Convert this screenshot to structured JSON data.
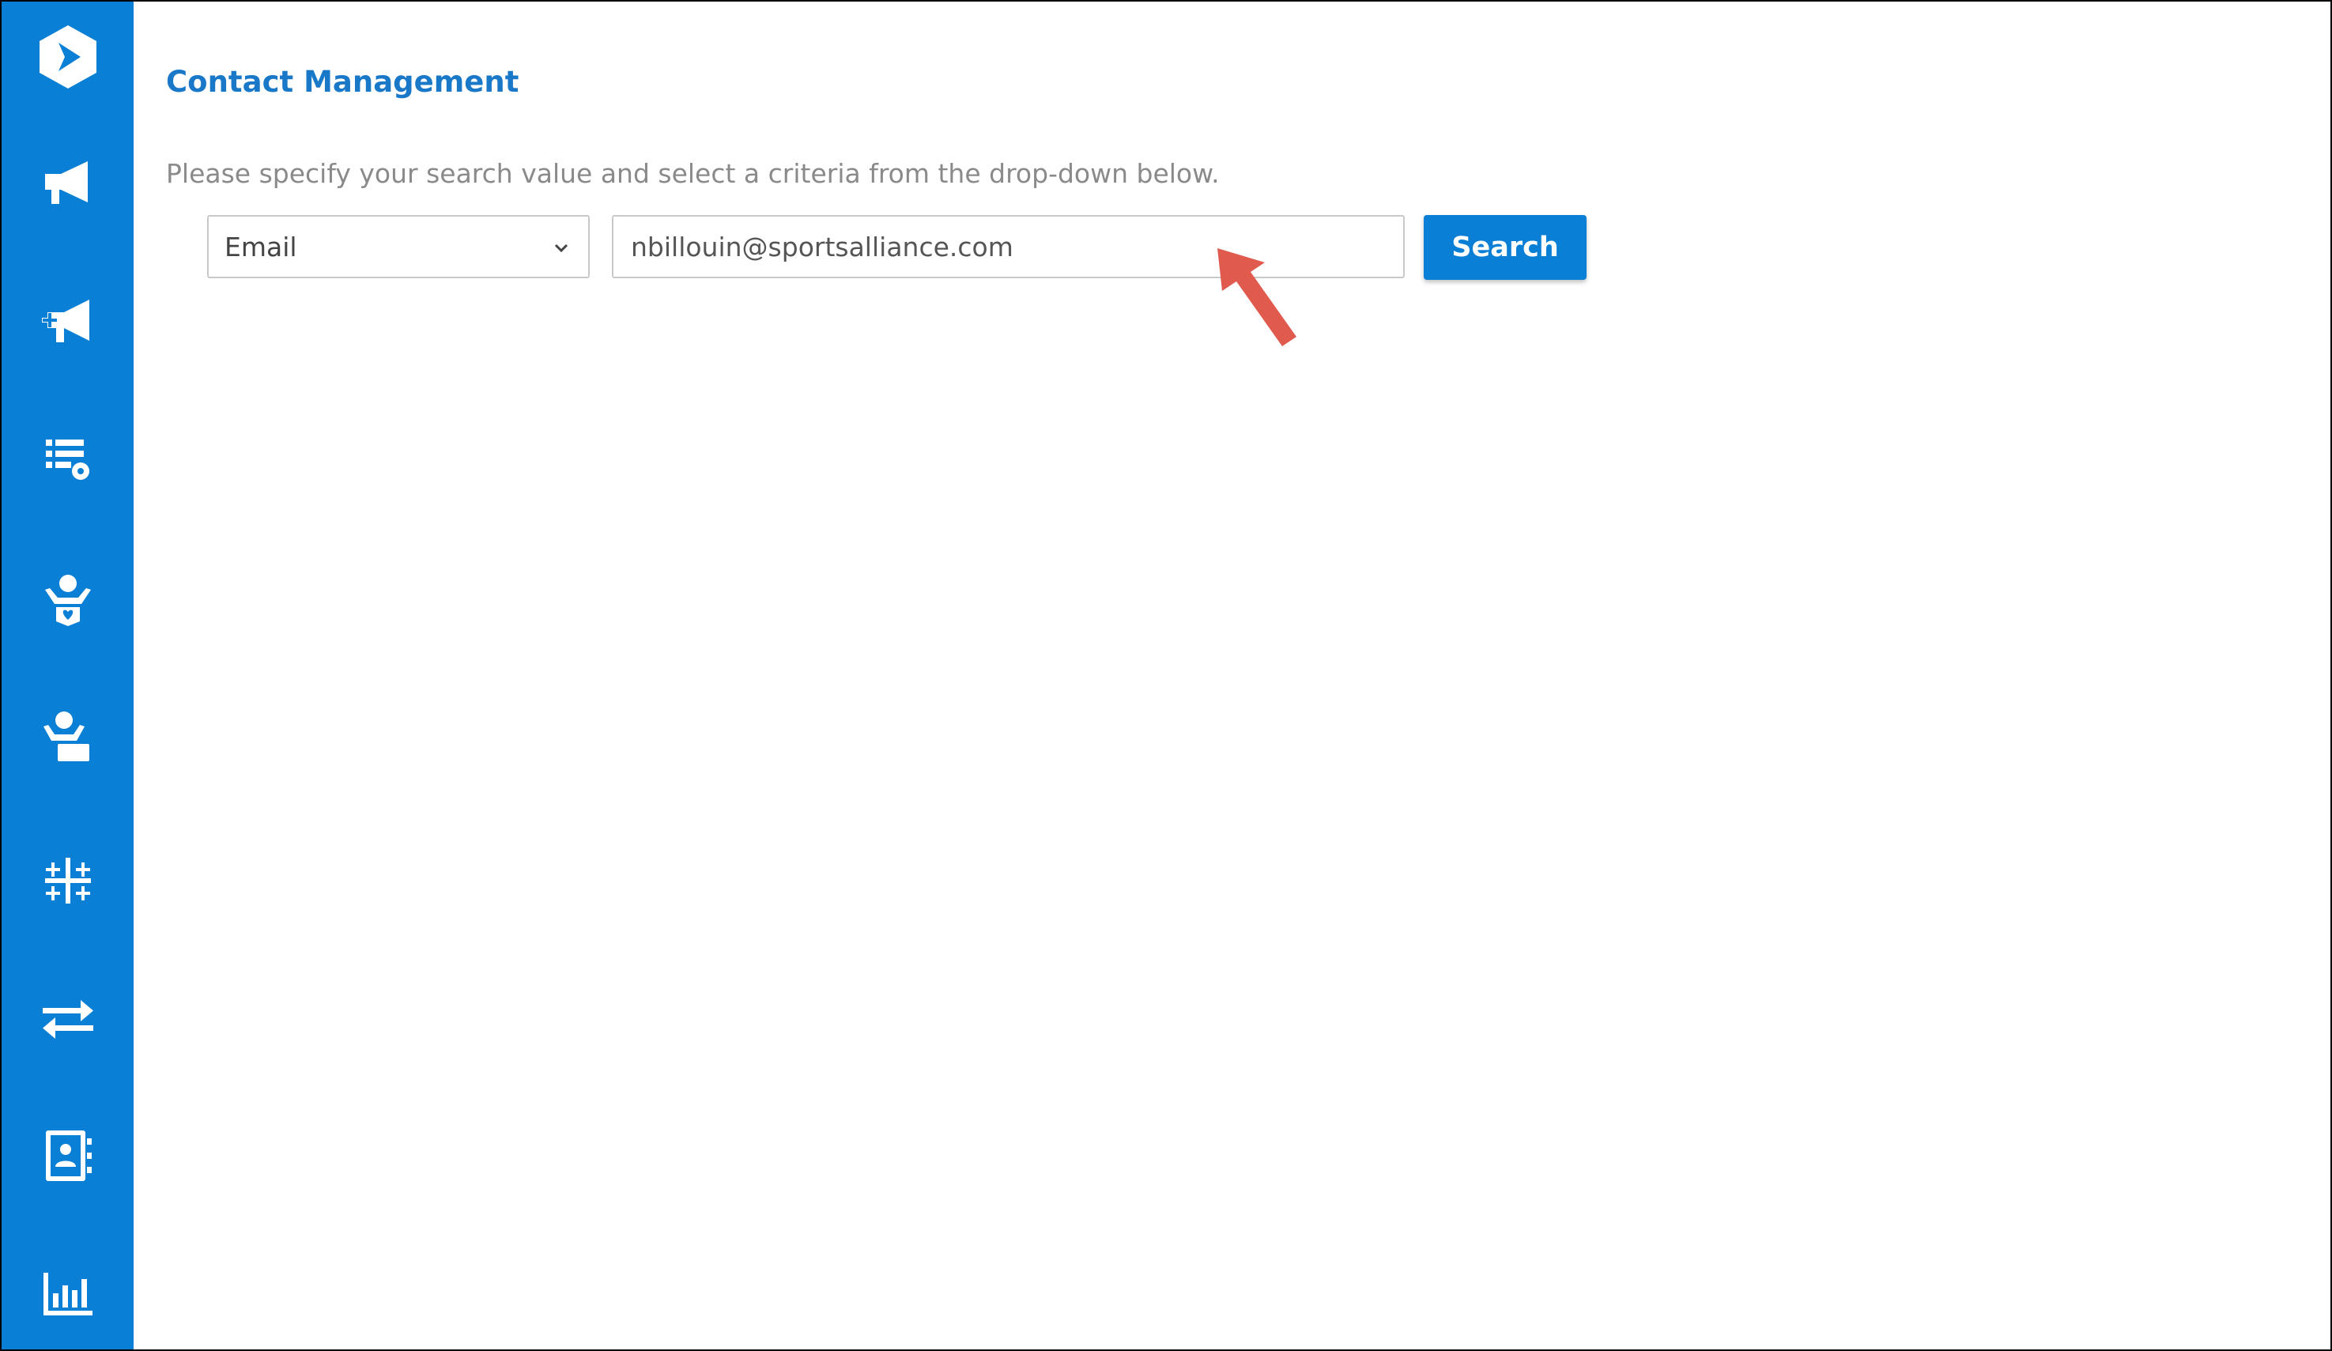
{
  "colors": {
    "accent": "#0a7fd6",
    "title": "#1a78c9",
    "annotation_arrow": "#e05a4e"
  },
  "sidebar": {
    "items": [
      {
        "icon": "logo-icon"
      },
      {
        "icon": "megaphone-icon"
      },
      {
        "icon": "megaphone-add-icon"
      },
      {
        "icon": "list-settings-icon"
      },
      {
        "icon": "user-heart-icon"
      },
      {
        "icon": "user-card-icon"
      },
      {
        "icon": "tableau-icon"
      },
      {
        "icon": "swap-arrows-icon"
      },
      {
        "icon": "contact-book-icon"
      },
      {
        "icon": "bar-chart-icon"
      }
    ]
  },
  "main": {
    "title": "Contact Management",
    "instructions": "Please specify your search value and select a criteria from the drop-down below.",
    "criteria_select": {
      "selected": "Email"
    },
    "search_input": {
      "value": "nbillouin@sportsalliance.com"
    },
    "search_button_label": "Search"
  }
}
